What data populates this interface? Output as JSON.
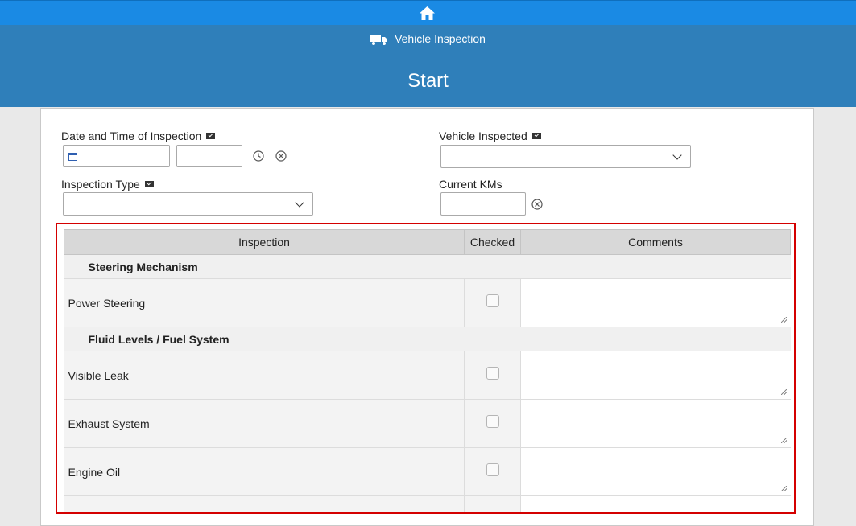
{
  "nav": {
    "home_icon": "home-icon"
  },
  "header": {
    "breadcrumb": "Vehicle Inspection",
    "breadcrumb_icon": "truck-icon",
    "title": "Start"
  },
  "form": {
    "date_label": "Date and Time of Inspection",
    "date_value": "",
    "time_value": "",
    "vehicle_label": "Vehicle Inspected",
    "vehicle_value": "",
    "type_label": "Inspection Type",
    "type_value": "",
    "kms_label": "Current KMs",
    "kms_value": ""
  },
  "grid": {
    "columns": [
      "Inspection",
      "Checked",
      "Comments"
    ],
    "sections": [
      {
        "title": "Steering Mechanism",
        "items": [
          {
            "name": "Power Steering",
            "checked": false,
            "comment": ""
          }
        ]
      },
      {
        "title": "Fluid Levels / Fuel System",
        "items": [
          {
            "name": "Visible Leak",
            "checked": false,
            "comment": ""
          },
          {
            "name": "Exhaust System",
            "checked": false,
            "comment": ""
          },
          {
            "name": "Engine Oil",
            "checked": false,
            "comment": ""
          },
          {
            "name": "",
            "checked": false,
            "comment": ""
          }
        ]
      }
    ]
  },
  "colors": {
    "nav": "#1a8ae4",
    "header": "#2f7fba",
    "highlight": "#d40000"
  }
}
